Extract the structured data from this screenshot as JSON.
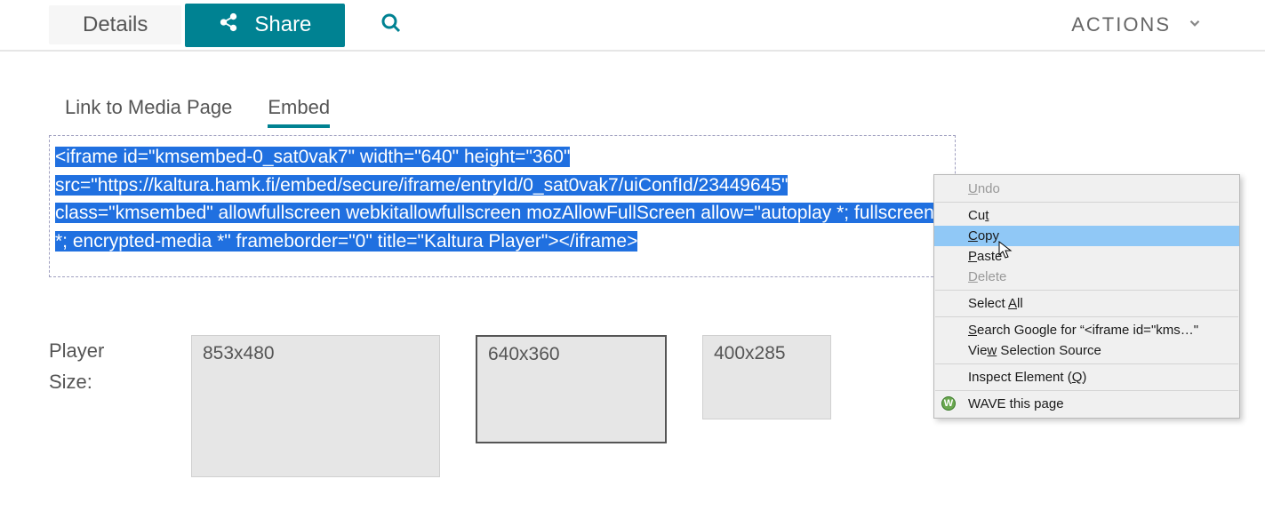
{
  "top": {
    "details_label": "Details",
    "share_label": "Share",
    "actions_label": "ACTIONS"
  },
  "subtabs": {
    "link_label": "Link to Media Page",
    "embed_label": "Embed"
  },
  "embed_code": "<iframe id=\"kmsembed-0_sat0vak7\" width=\"640\" height=\"360\" src=\"https://kaltura.hamk.fi/embed/secure/iframe/entryId/0_sat0vak7/uiConfId/23449645\" class=\"kmsembed\" allowfullscreen webkitallowfullscreen mozAllowFullScreen allow=\"autoplay *; fullscreen *; encrypted-media *\" frameborder=\"0\" title=\"Kaltura Player\"></iframe>",
  "player": {
    "label_line1": "Player",
    "label_line2": "Size:",
    "sizes": [
      "853x480",
      "640x360",
      "400x285"
    ]
  },
  "context_menu": {
    "undo": "Undo",
    "cut": "Cut",
    "copy": "Copy",
    "paste": "Paste",
    "delete": "Delete",
    "select_all": "Select All",
    "search": "Search Google for “<iframe id=\"kms…\"",
    "view_source": "View Selection Source",
    "inspect": "Inspect Element (Q)",
    "wave": "WAVE this page"
  }
}
